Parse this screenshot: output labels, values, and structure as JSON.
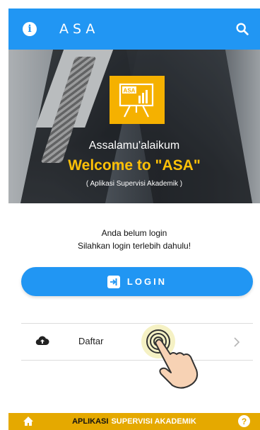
{
  "appbar": {
    "title": "ASA",
    "color": "#2196f3",
    "icons": {
      "left": "info-icon",
      "right": "search-icon"
    }
  },
  "hero": {
    "logo_text": "ASA",
    "greeting": "Assalamu'alaikum",
    "welcome": "Welcome to \"ASA\"",
    "subtitle": "( Aplikasi Supervisi Akademik )",
    "logo_color": "#f5b100",
    "welcome_color": "#ffc107"
  },
  "main": {
    "message_line1": "Anda belum login",
    "message_line2": "Silahkan login terlebih dahulu!",
    "login_button": {
      "label": "LOGIN",
      "icon": "login-icon"
    },
    "menu": [
      {
        "label": "Daftar",
        "icon": "cloud-upload-icon",
        "trailing_icon": "chevron-right-icon"
      }
    ]
  },
  "bottombar": {
    "text_part1": "APLIKASI",
    "text_part2": "SUPERVISI AKADEMIK",
    "color": "#e5a900",
    "icons": {
      "left": "home-icon",
      "right": "help-icon"
    }
  }
}
